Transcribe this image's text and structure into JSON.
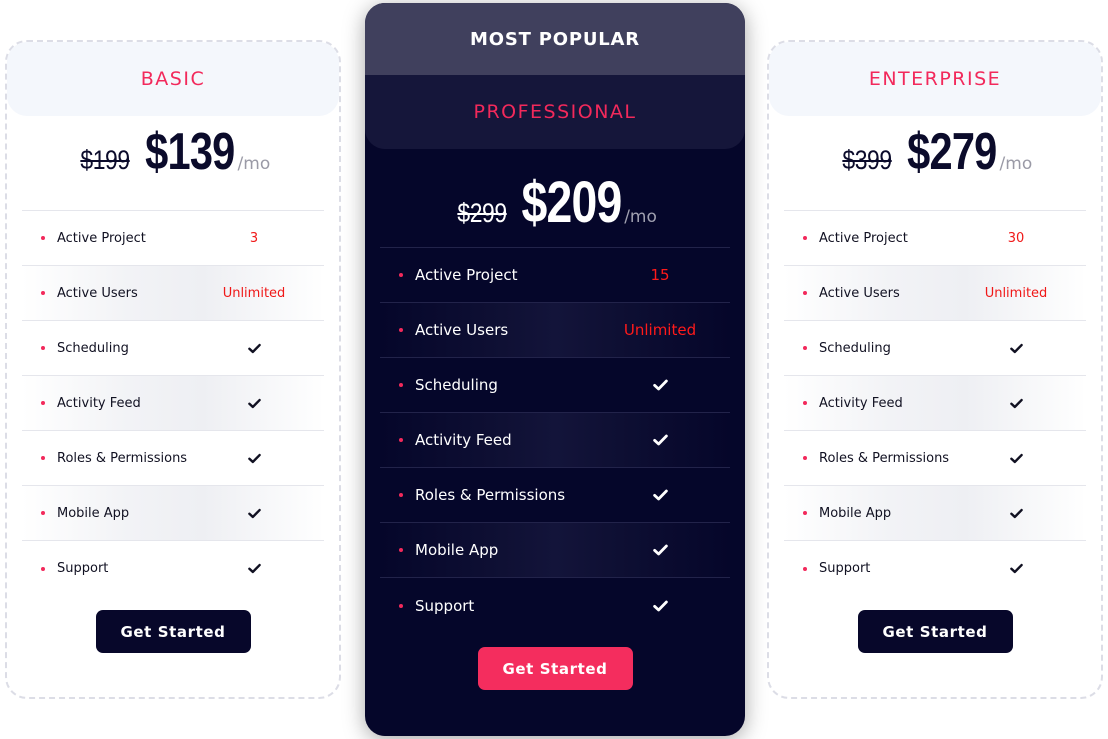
{
  "colors": {
    "accent": "#f2295b",
    "dark": "#07072a",
    "value_red": "#f01818",
    "badge_bg": "#40405d"
  },
  "plans": [
    {
      "name": "BASIC",
      "old_price": "$199",
      "price": "$139",
      "period": "/mo",
      "features": [
        {
          "label": "Active Project",
          "value": "3"
        },
        {
          "label": "Active Users",
          "value": "Unlimited"
        },
        {
          "label": "Scheduling",
          "icon": "check-icon"
        },
        {
          "label": "Activity Feed",
          "icon": "check-icon"
        },
        {
          "label": "Roles & Permissions",
          "icon": "check-icon"
        },
        {
          "label": "Mobile App",
          "icon": "check-icon"
        },
        {
          "label": "Support",
          "icon": "check-icon"
        }
      ],
      "cta": "Get Started"
    },
    {
      "badge": "MOST POPULAR",
      "name": "PROFESSIONAL",
      "old_price": "$299",
      "price": "$209",
      "period": "/mo",
      "features": [
        {
          "label": "Active Project",
          "value": "15"
        },
        {
          "label": "Active Users",
          "value": "Unlimited"
        },
        {
          "label": "Scheduling",
          "icon": "check-icon"
        },
        {
          "label": "Activity Feed",
          "icon": "check-icon"
        },
        {
          "label": "Roles & Permissions",
          "icon": "check-icon"
        },
        {
          "label": "Mobile App",
          "icon": "check-icon"
        },
        {
          "label": "Support",
          "icon": "check-icon"
        }
      ],
      "cta": "Get Started"
    },
    {
      "name": "ENTERPRISE",
      "old_price": "$399",
      "price": "$279",
      "period": "/mo",
      "features": [
        {
          "label": "Active Project",
          "value": "30"
        },
        {
          "label": "Active Users",
          "value": "Unlimited"
        },
        {
          "label": "Scheduling",
          "icon": "check-icon"
        },
        {
          "label": "Activity Feed",
          "icon": "check-icon"
        },
        {
          "label": "Roles & Permissions",
          "icon": "check-icon"
        },
        {
          "label": "Mobile App",
          "icon": "check-icon"
        },
        {
          "label": "Support",
          "icon": "check-icon"
        }
      ],
      "cta": "Get Started"
    }
  ]
}
